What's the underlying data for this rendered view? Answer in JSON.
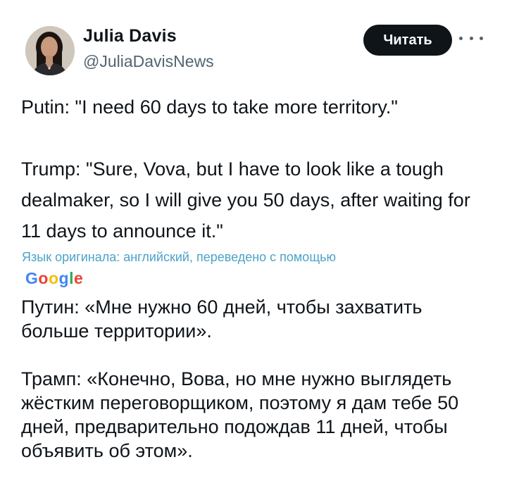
{
  "author": {
    "name": "Julia Davis",
    "handle": "@JuliaDavisNews"
  },
  "follow_button_label": "Читать",
  "tweet_text": "Putin: \"I need 60 days to take more territory.\"\n\nTrump: \"Sure, Vova, but I have to look like a tough dealmaker, so I will give you 50 days, after waiting for 11 days to announce it.\"",
  "translation_note": "Язык оригинала: английский, переведено с помощью",
  "translation_provider": "Google",
  "translated_text": "Путин: «Мне нужно 60 дней, чтобы захватить больше территории».\n\nТрамп: «Конечно, Вова, но мне нужно выглядеть жёстким переговорщиком, поэтому я дам тебе 50 дней, предварительно подождав 11 дней, чтобы объявить об этом».",
  "colors": {
    "follow_button_bg": "#0f1419",
    "translation_link": "#4ba3c8",
    "handle_gray": "#536471"
  },
  "icons": [
    "more-options-icon"
  ]
}
